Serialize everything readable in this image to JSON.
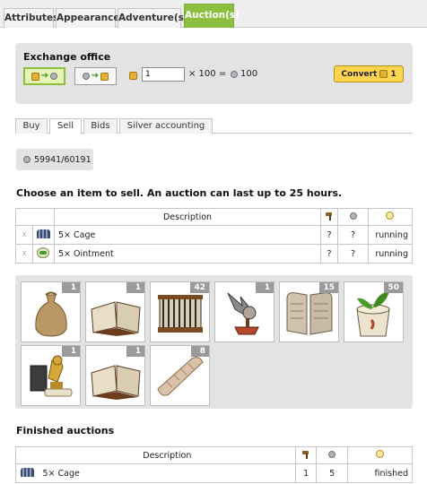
{
  "top_tabs": [
    {
      "label": "Attributes"
    },
    {
      "label": "Appearance"
    },
    {
      "label": "Adventure(s)"
    },
    {
      "label": "Auction(s)"
    }
  ],
  "exchange": {
    "title": "Exchange office",
    "amount_value": "1",
    "multiplier_text": "× 100 =",
    "result": "100",
    "convert_label": "Convert",
    "convert_amount": "1"
  },
  "sub_tabs": [
    {
      "label": "Buy"
    },
    {
      "label": "Sell"
    },
    {
      "label": "Bids"
    },
    {
      "label": "Silver accounting"
    }
  ],
  "silver_balance": "59941/60191",
  "sell_heading": "Choose an item to sell. An auction can last up to 25 hours.",
  "auctions_table": {
    "description_header": "Description",
    "rows": [
      {
        "delete": "x",
        "name": "5× Cage",
        "bid": "?",
        "silver": "?",
        "status": "running"
      },
      {
        "delete": "x",
        "name": "5× Ointment",
        "bid": "?",
        "silver": "?",
        "status": "running"
      }
    ]
  },
  "inventory": [
    {
      "icon": "sack-icon",
      "qty": "1"
    },
    {
      "icon": "book-icon",
      "qty": "1"
    },
    {
      "icon": "cage-icon",
      "qty": "42"
    },
    {
      "icon": "bird-statue-icon",
      "qty": "1"
    },
    {
      "icon": "stone-tablets-icon",
      "qty": "15"
    },
    {
      "icon": "ointment-pot-icon",
      "qty": "50"
    },
    {
      "icon": "eagle-statue-icon",
      "qty": "1"
    },
    {
      "icon": "book-icon",
      "qty": "1"
    },
    {
      "icon": "bandage-icon",
      "qty": "8"
    }
  ],
  "finished_heading": "Finished auctions",
  "finished_table": {
    "description_header": "Description",
    "rows": [
      {
        "name": "5× Cage",
        "bids": "1",
        "silver": "5",
        "status": "finished"
      }
    ]
  },
  "colors": {
    "accent_green": "#8cbf3f",
    "panel_gray": "#e3e3e3",
    "convert_yellow": "#ffd54e"
  }
}
